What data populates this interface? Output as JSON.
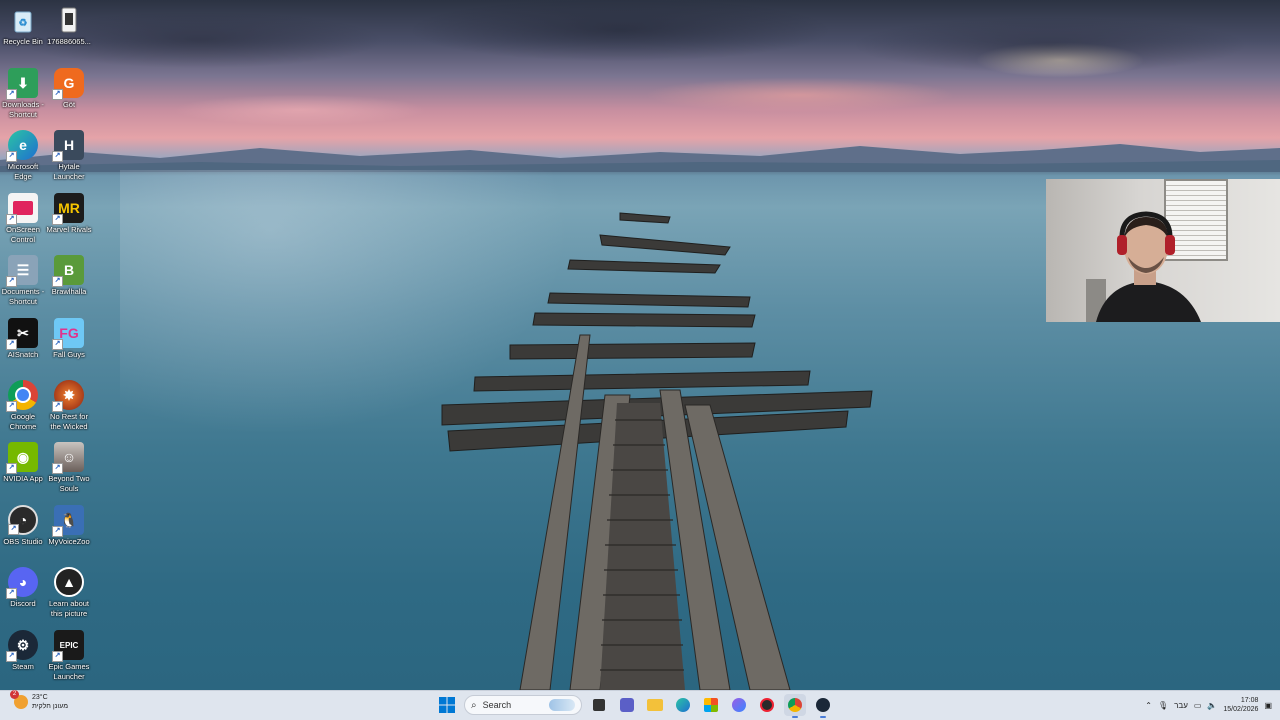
{
  "desktop_icons": [
    {
      "label": "Recycle Bin",
      "icon": "recycle-bin-icon"
    },
    {
      "label": "176886065...",
      "icon": "file-icon"
    },
    {
      "label": "Downloads - Shortcut",
      "icon": "downloads-folder-icon"
    },
    {
      "label": "Göt",
      "icon": "gdlauncher-icon"
    },
    {
      "label": "Microsoft Edge",
      "icon": "edge-icon"
    },
    {
      "label": "Hytale Launcher",
      "icon": "hytale-icon"
    },
    {
      "label": "OnScreen Control",
      "icon": "onscreen-control-icon"
    },
    {
      "label": "Marvel Rivals",
      "icon": "marvel-rivals-icon"
    },
    {
      "label": "Documents - Shortcut",
      "icon": "documents-folder-icon"
    },
    {
      "label": "Brawlhalla",
      "icon": "brawlhalla-icon"
    },
    {
      "label": "AISnatch",
      "icon": "aisnatch-icon"
    },
    {
      "label": "Fall Guys",
      "icon": "fall-guys-icon"
    },
    {
      "label": "Google Chrome",
      "icon": "chrome-icon"
    },
    {
      "label": "No Rest for the Wicked",
      "icon": "no-rest-for-the-wicked-icon"
    },
    {
      "label": "NVIDIA App",
      "icon": "nvidia-icon"
    },
    {
      "label": "Beyond Two Souls",
      "icon": "beyond-two-souls-icon"
    },
    {
      "label": "OBS Studio",
      "icon": "obs-icon"
    },
    {
      "label": "MyVoiceZoo",
      "icon": "myvoicezoo-icon"
    },
    {
      "label": "Discord",
      "icon": "discord-icon"
    },
    {
      "label": "Learn about this picture",
      "icon": "learn-about-picture-icon"
    },
    {
      "label": "Steam",
      "icon": "steam-icon"
    },
    {
      "label": "Epic Games Launcher",
      "icon": "epic-games-icon"
    }
  ],
  "taskbar": {
    "weather": {
      "temp": "23°C",
      "desc": "מעונן חלקית",
      "badge": "2"
    },
    "search_placeholder": "Search",
    "pinned": [
      "windows-start-icon",
      "search-icon",
      "task-view-icon",
      "teams-icon",
      "file-explorer-icon",
      "edge-icon",
      "microsoft-store-icon",
      "messenger-icon",
      "davinci-icon",
      "chrome-icon",
      "steam-icon"
    ],
    "tray": {
      "language": "עבר",
      "time": "17:08",
      "date": "15/02/2026"
    }
  },
  "colors": {
    "taskbar_bg": "#dfe5ee",
    "accent": "#0078d4"
  }
}
